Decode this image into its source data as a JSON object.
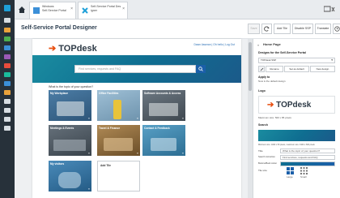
{
  "tabs": [
    {
      "line1": "Windows",
      "line2": "Self-Service Portal",
      "close": "×"
    },
    {
      "line1": "Self-Service Portal Des",
      "line2": "igner",
      "close": "×"
    }
  ],
  "toolbar": {
    "title": "Self-Service Portal Designer",
    "save": "Save",
    "add_tile": "Add Tile",
    "disable_ssp": "Disable SSP",
    "translate": "Translate"
  },
  "portal": {
    "logo_text": "TOPdesk",
    "logo_arrow": "➔",
    "header_links": "Dawn Assman  |  Oh hello | Log Out",
    "search_placeholder": "Find services, requests and FAQ",
    "question": "What is the topic of your question?",
    "tiles": [
      {
        "label": "My Workplace",
        "color": "#3f6f99",
        "chev": "»"
      },
      {
        "label": "Office Facilities",
        "color": "#7aa6c4",
        "chev": "»"
      },
      {
        "label": "Software Accounts & Access",
        "color": "#55606b",
        "chev": "»"
      },
      {
        "label": "Meetings & Events",
        "color": "#4f5a64",
        "chev": "»"
      },
      {
        "label": "Travel & Finance",
        "color": "#8a6a3c",
        "chev": "»"
      },
      {
        "label": "Contact & Feedback",
        "color": "#3a7fa6",
        "chev": "»"
      },
      {
        "label": "My visitors",
        "color": "#2f6e9e",
        "chev": "»"
      }
    ],
    "add_tile_label": "Add Tile"
  },
  "panel": {
    "collapse": "«",
    "home_page": "Home Page",
    "designs_heading": "Designs for the Self-Service Portal",
    "design_selected": "TOPdesk SSP",
    "caret": "▾",
    "rename": "Rename",
    "set_as_default": "Set as default",
    "new_design": "New design",
    "apply_to_heading": "Apply to",
    "apply_to_text": "Now is the default design",
    "logo_heading": "Logo",
    "logo_hint": "Maximum size: 500 x 85 pixels",
    "search_heading": "Search",
    "search_hint": "Minimum size: 1000 x 50 pixels, maximum size: 1900 x 600 pixels",
    "title_label": "Title",
    "title_value": "What is the topic of your question?",
    "search_instruction_label": "Search instruction",
    "search_instruction_value": "Find services, requests and FAQ",
    "buttons_label": "Buttons/Back colour",
    "tile_size_label": "Tile size",
    "tile_large": "Large",
    "tile_small": "Small"
  },
  "colors": {
    "rail": "#27313a",
    "accent_orange": "#e84e0f",
    "accent_blue": "#1b5fa9",
    "teal": "#0f6e91"
  }
}
